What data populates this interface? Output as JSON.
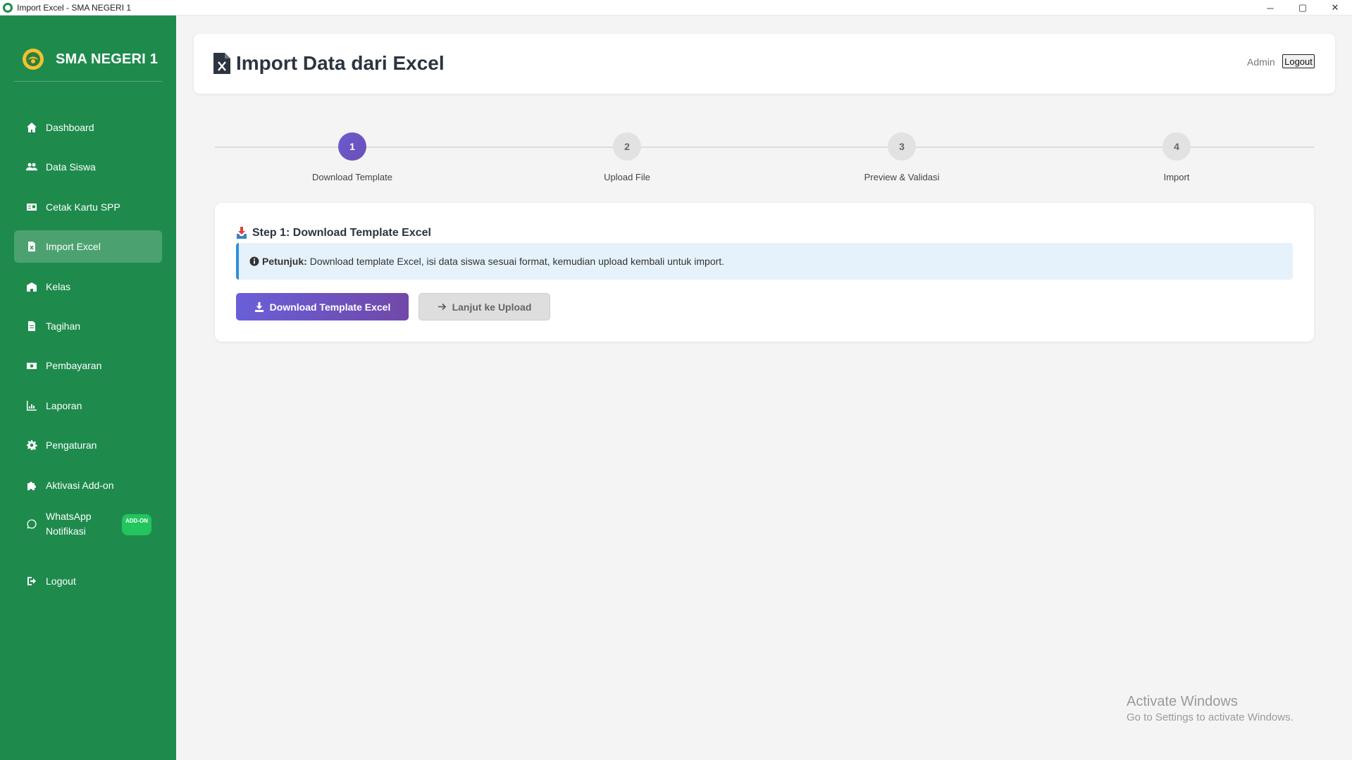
{
  "window": {
    "title": "Import Excel - SMA NEGERI 1",
    "controls": {
      "minimize": "─",
      "maximize": "▢",
      "close": "✕"
    }
  },
  "sidebar": {
    "brand_name": "SMA NEGERI 1",
    "items": [
      {
        "label": "Dashboard",
        "icon": "home-icon",
        "active": false
      },
      {
        "label": "Data Siswa",
        "icon": "users-icon",
        "active": false
      },
      {
        "label": "Cetak Kartu SPP",
        "icon": "id-card-icon",
        "active": false
      },
      {
        "label": "Import Excel",
        "icon": "file-excel-icon",
        "active": true
      },
      {
        "label": "Kelas",
        "icon": "school-icon",
        "active": false
      },
      {
        "label": "Tagihan",
        "icon": "invoice-icon",
        "active": false
      },
      {
        "label": "Pembayaran",
        "icon": "money-icon",
        "active": false
      },
      {
        "label": "Laporan",
        "icon": "chart-icon",
        "active": false
      },
      {
        "label": "Pengaturan",
        "icon": "gear-icon",
        "active": false
      },
      {
        "label": "Aktivasi Add-on",
        "icon": "puzzle-icon",
        "active": false
      },
      {
        "label": "WhatsApp Notifikasi",
        "icon": "whatsapp-icon",
        "active": false,
        "badge": "ADD-ON"
      },
      {
        "label": "Logout",
        "icon": "logout-icon",
        "active": false
      }
    ]
  },
  "header": {
    "title": "Import Data dari Excel",
    "user": "Admin",
    "logout_label": "Logout"
  },
  "stepper": {
    "steps": [
      {
        "number": "1",
        "label": "Download Template",
        "active": true
      },
      {
        "number": "2",
        "label": "Upload File",
        "active": false
      },
      {
        "number": "3",
        "label": "Preview & Validasi",
        "active": false
      },
      {
        "number": "4",
        "label": "Import",
        "active": false
      }
    ]
  },
  "step_card": {
    "heading": "Step 1: Download Template Excel",
    "info_bold": "Petunjuk:",
    "info_text": "Download template Excel, isi data siswa sesuai format, kemudian upload kembali untuk import.",
    "download_button": "Download Template Excel",
    "next_button": "Lanjut ke Upload"
  },
  "watermark": {
    "line1": "Activate Windows",
    "line2": "Go to Settings to activate Windows."
  },
  "colors": {
    "sidebar_bg": "#1e8b4d",
    "accent_purple": "#6a5fd8",
    "addon_badge": "#22c55e",
    "info_border": "#2f8fdb"
  }
}
